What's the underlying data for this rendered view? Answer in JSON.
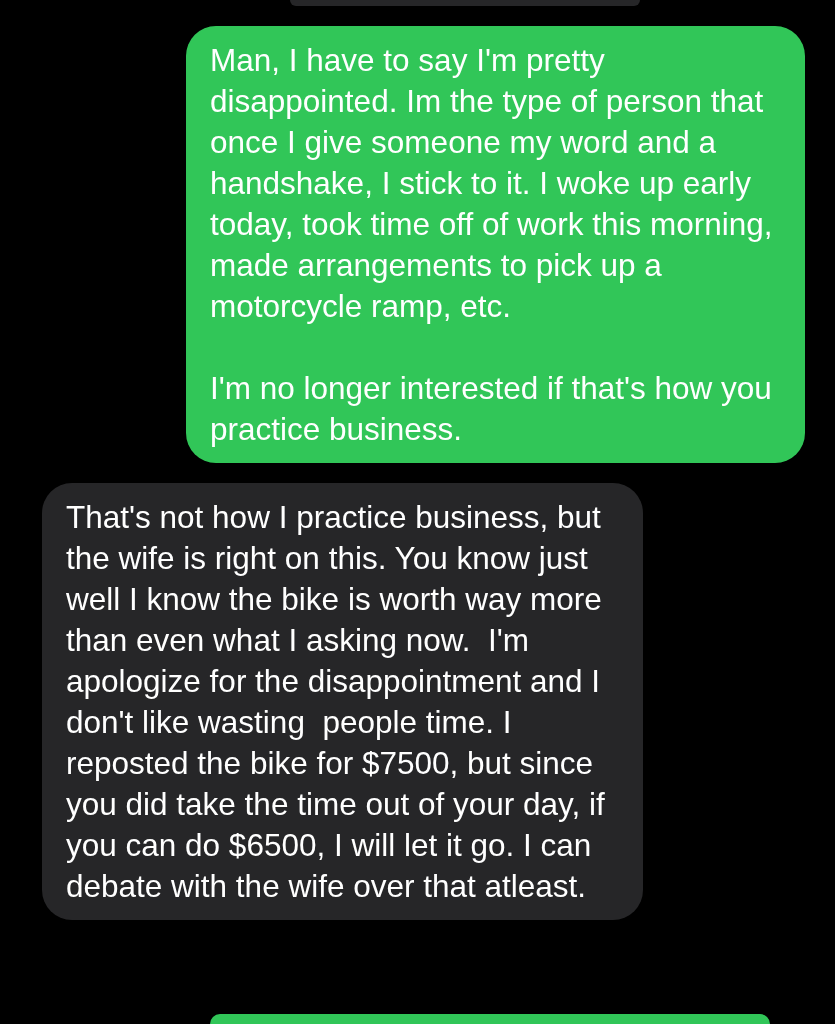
{
  "messages": [
    {
      "kind": "received"
    },
    {
      "kind": "sent",
      "paragraphs": [
        "Man, I have to say I'm pretty disappointed. Im the type of person that once I give someone my word and a handshake, I stick to it. I woke up early today, took time off of work this morning, made arrangements to pick up a motorcycle ramp, etc.",
        "I'm no longer interested if that's how you practice business."
      ]
    },
    {
      "kind": "received",
      "paragraphs": [
        "That's not how I practice business, but the wife is right on this. You know just well I know the bike is worth way more than even what I asking now.  I'm apologize for the disappointment and I don't like wasting  people time. I reposted the bike for $7500, but since you did take the time out of your day, if you can do $6500, I will let it go. I can debate with the wife over that atleast."
      ]
    },
    {
      "kind": "sent"
    }
  ]
}
